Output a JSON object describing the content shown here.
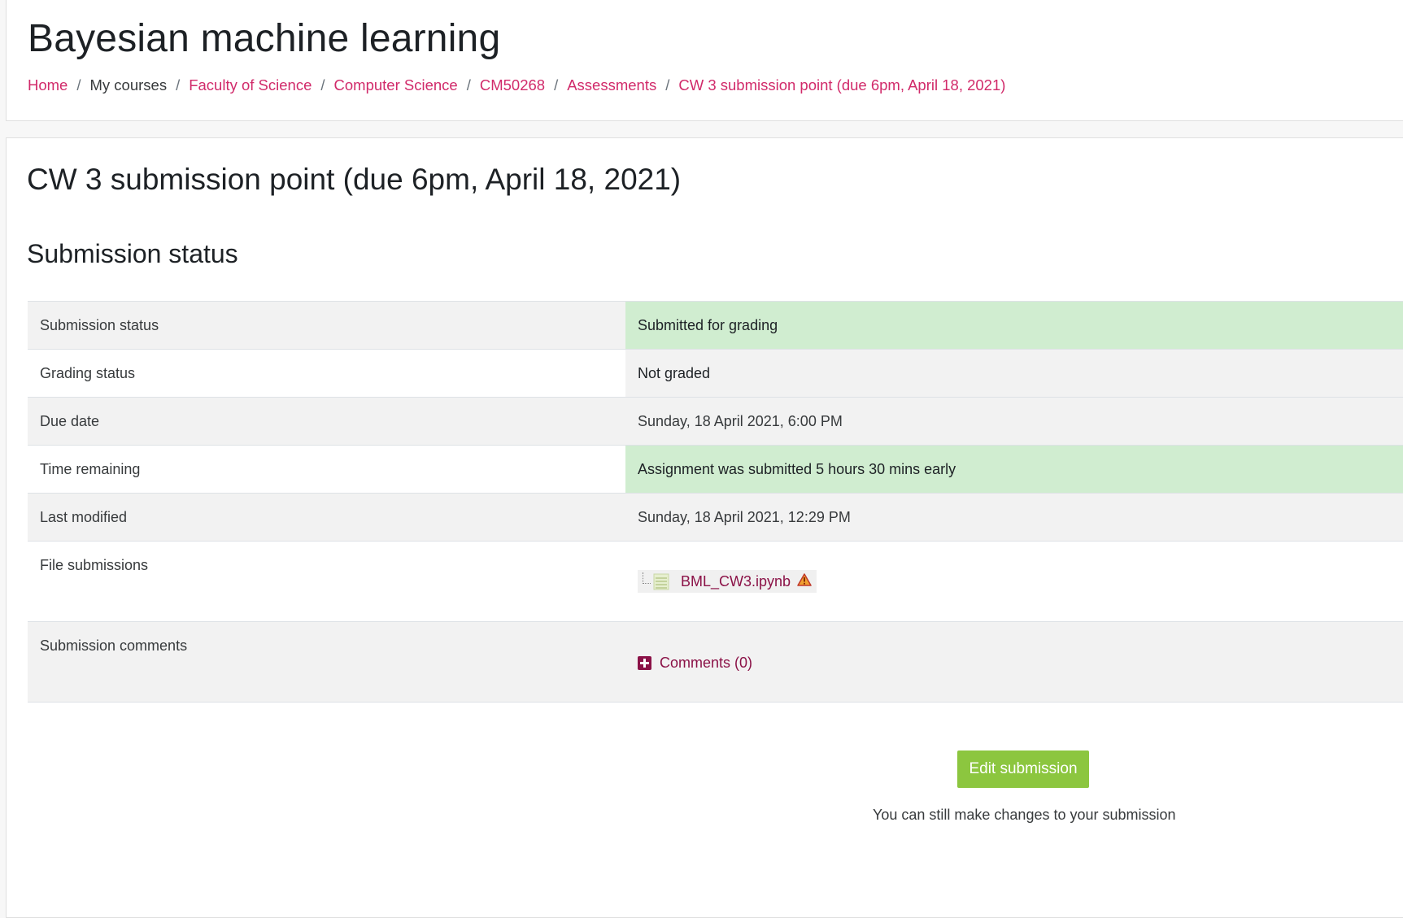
{
  "header": {
    "course_title": "Bayesian machine learning",
    "breadcrumb": [
      {
        "label": "Home",
        "link": true
      },
      {
        "label": "My courses",
        "link": false
      },
      {
        "label": "Faculty of Science",
        "link": true
      },
      {
        "label": "Computer Science",
        "link": true
      },
      {
        "label": "CM50268",
        "link": true
      },
      {
        "label": "Assessments",
        "link": true
      },
      {
        "label": "CW 3 submission point (due 6pm, April 18, 2021)",
        "link": true
      }
    ],
    "separator": "/"
  },
  "main": {
    "page_heading": "CW 3 submission point (due 6pm, April 18, 2021)",
    "section_heading": "Submission status",
    "status_rows": [
      {
        "label": "Submission status",
        "value": "Submitted for grading"
      },
      {
        "label": "Grading status",
        "value": "Not graded"
      },
      {
        "label": "Due date",
        "value": "Sunday, 18 April 2021, 6:00 PM"
      },
      {
        "label": "Time remaining",
        "value": "Assignment was submitted 5 hours 30 mins early"
      },
      {
        "label": "Last modified",
        "value": "Sunday, 18 April 2021, 12:29 PM"
      },
      {
        "label": "File submissions",
        "file_name": "BML_CW3.ipynb"
      },
      {
        "label": "Submission comments",
        "comments_label": "Comments (0)"
      }
    ],
    "edit_button_label": "Edit submission",
    "help_text": "You can still make changes to your submission"
  },
  "colors": {
    "link": "#d12a6a",
    "success_bg": "#d0edd0",
    "button_green": "#8cc63f",
    "file_link": "#8b1247"
  }
}
